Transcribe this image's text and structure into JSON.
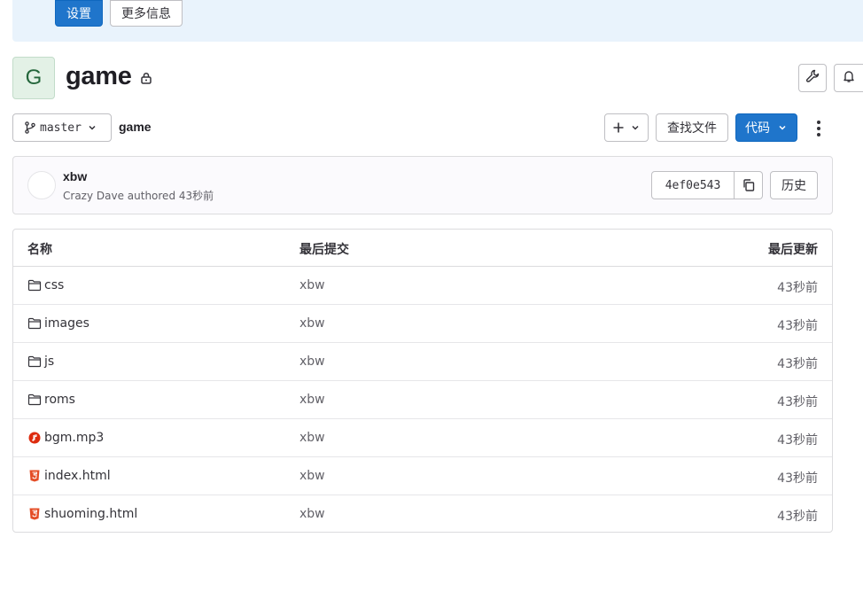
{
  "banner": {
    "settings_label": "设置",
    "more_info_label": "更多信息"
  },
  "project": {
    "avatar_letter": "G",
    "name": "game",
    "visibility_icon": "lock-icon"
  },
  "toolbar": {
    "branch": "master",
    "breadcrumb": "game",
    "find_file_label": "查找文件",
    "code_label": "代码"
  },
  "commit": {
    "title": "xbw",
    "author_text": "Crazy Dave authored 43秒前",
    "sha": "4ef0e543",
    "history_label": "历史"
  },
  "table": {
    "headers": {
      "name": "名称",
      "last_commit": "最后提交",
      "last_update": "最后更新"
    },
    "rows": [
      {
        "name": "css",
        "type": "folder",
        "commit": "xbw",
        "time": "43秒前"
      },
      {
        "name": "images",
        "type": "folder",
        "commit": "xbw",
        "time": "43秒前"
      },
      {
        "name": "js",
        "type": "folder",
        "commit": "xbw",
        "time": "43秒前"
      },
      {
        "name": "roms",
        "type": "folder",
        "commit": "xbw",
        "time": "43秒前"
      },
      {
        "name": "bgm.mp3",
        "type": "audio",
        "commit": "xbw",
        "time": "43秒前"
      },
      {
        "name": "index.html",
        "type": "html",
        "commit": "xbw",
        "time": "43秒前"
      },
      {
        "name": "shuoming.html",
        "type": "html",
        "commit": "xbw",
        "time": "43秒前"
      }
    ]
  },
  "colors": {
    "primary": "#1f75cb",
    "banner_bg": "#e9f3fc",
    "audio_icon": "#dd2b0e",
    "html_icon": "#e44d26"
  }
}
